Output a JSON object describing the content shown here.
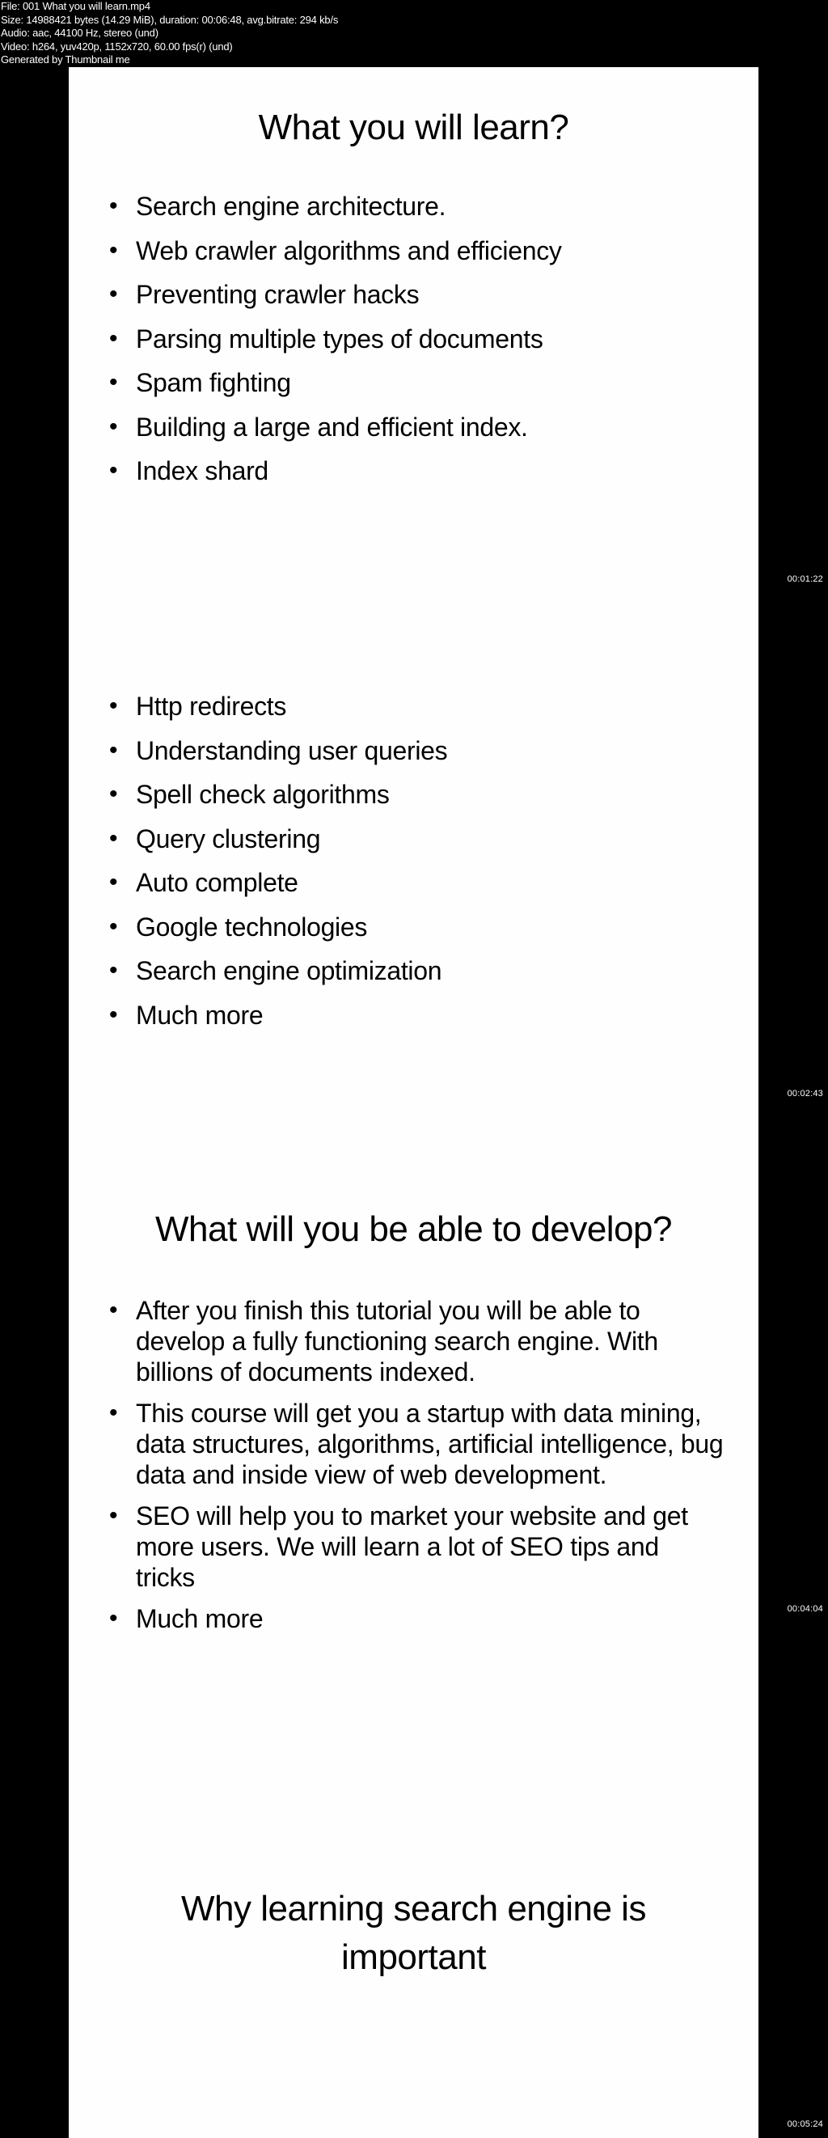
{
  "info": {
    "file": "File: 001 What you will learn.mp4",
    "size": "Size: 14988421 bytes (14.29 MiB), duration: 00:06:48, avg.bitrate: 294 kb/s",
    "audio": "Audio: aac, 44100 Hz, stereo (und)",
    "video": "Video: h264, yuv420p, 1152x720, 60.00 fps(r) (und)",
    "generator": "Generated by Thumbnail me"
  },
  "frames": [
    {
      "timestamp": "00:01:22",
      "title": "What you will learn?",
      "bullets": [
        "Search engine architecture.",
        "Web crawler algorithms and efficiency",
        "Preventing crawler hacks",
        "Parsing multiple types of documents",
        "Spam fighting",
        "Building a large and efficient index.",
        "Index shard"
      ]
    },
    {
      "timestamp": "00:02:43",
      "bullets": [
        "Http redirects",
        "Understanding user queries",
        "Spell check algorithms",
        "Query clustering",
        "Auto complete",
        "Google technologies",
        "Search engine optimization",
        "Much more"
      ]
    },
    {
      "timestamp": "00:04:04",
      "title": "What will you be able to develop?",
      "bullets": [
        "After you finish this tutorial you will be able to develop a fully functioning search engine. With billions of documents indexed.",
        "This course will get you a startup with data mining, data structures, algorithms, artificial intelligence, bug data and inside view of web development.",
        "SEO will help you to market your website and get more users. We will learn a lot of SEO tips and tricks",
        "Much more"
      ]
    },
    {
      "timestamp": "00:05:24",
      "title": "Why learning search engine is important"
    }
  ],
  "bullet_glyph": "•"
}
